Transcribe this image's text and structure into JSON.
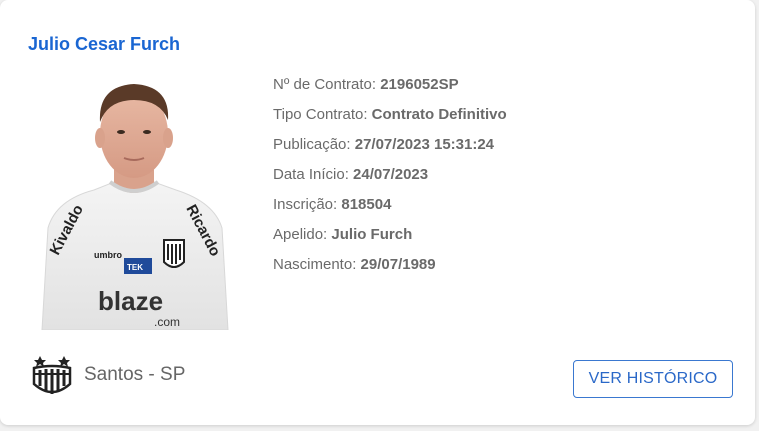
{
  "player": {
    "name": "Julio Cesar Furch",
    "contract_number_label": "Nº de Contrato:",
    "contract_number": "2196052SP",
    "contract_type_label": "Tipo Contrato:",
    "contract_type": "Contrato Definitivo",
    "publication_label": "Publicação:",
    "publication": "27/07/2023 15:31:24",
    "start_date_label": "Data Início:",
    "start_date": "24/07/2023",
    "registration_label": "Inscrição:",
    "registration": "818504",
    "nickname_label": "Apelido:",
    "nickname": "Julio Furch",
    "birth_label": "Nascimento:",
    "birth": "29/07/1989"
  },
  "club": {
    "name": "Santos - SP",
    "logo_icon": "santos-crest-icon"
  },
  "actions": {
    "history_button": "VER HISTÓRICO"
  },
  "colors": {
    "name_blue": "#1a66d2",
    "button_blue": "#2a68c8"
  }
}
